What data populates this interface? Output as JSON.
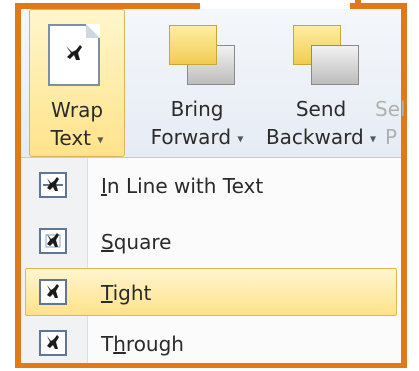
{
  "ribbon": {
    "wrap_text": {
      "line1": "Wrap",
      "line2": "Text",
      "icon": "wrap-text-icon"
    },
    "bring_forward": {
      "line1": "Bring",
      "line2": "Forward",
      "icon": "bring-forward-icon"
    },
    "send_backward": {
      "line1": "Send",
      "line2": "Backward",
      "icon": "send-backward-icon"
    },
    "selection_pane": {
      "line1": "Sel",
      "line2": "P"
    }
  },
  "menu": {
    "items": [
      {
        "label": "In Line with Text",
        "accel": "I",
        "rest": "n Line with Text",
        "icon": "inline-wrap-icon",
        "highlighted": false
      },
      {
        "label": "Square",
        "accel": "S",
        "rest": "quare",
        "icon": "square-wrap-icon",
        "highlighted": false
      },
      {
        "label": "Tight",
        "accel": "T",
        "rest": "ight",
        "icon": "tight-wrap-icon",
        "highlighted": true
      },
      {
        "label": "Through",
        "pre": "T",
        "accel": "h",
        "rest": "rough",
        "icon": "through-wrap-icon",
        "highlighted": false
      }
    ]
  },
  "colors": {
    "frame": "#E07A18",
    "highlight": "#FFE28A"
  }
}
